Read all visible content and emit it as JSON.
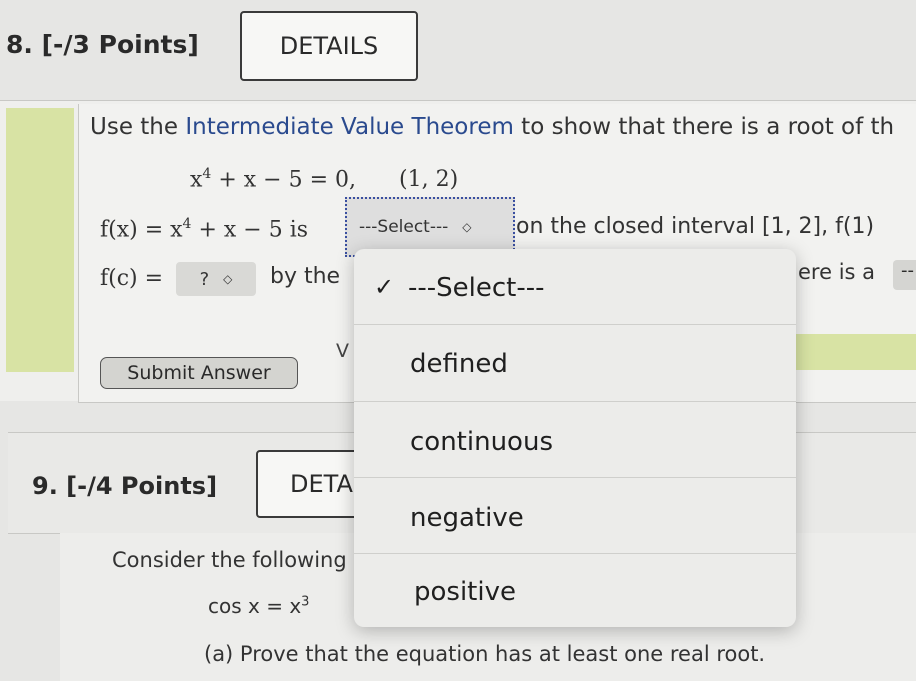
{
  "q8": {
    "title": "8.  [-/3 Points]",
    "details_label": "DETAILS",
    "prompt_intro": "Use the ",
    "prompt_theorem": "Intermediate Value Theorem",
    "prompt_rest": " to show that there is a root of th",
    "equation_lhs": "x",
    "equation_exp": "4",
    "equation_rest": " + x − 5 = 0,",
    "interval": "(1, 2)",
    "fx_label": "f(x) = x",
    "fx_exp": "4",
    "fx_rest": " + x − 5  is",
    "select1_value": "---Select---",
    "after_select1": "on the closed interval [1, 2],  f(1)",
    "fc_label": "f(c) = ",
    "select2_value": "?",
    "by_the": "by the",
    "trailing_text": "ere is a",
    "trailing_chip": "--",
    "fragment_v": "V",
    "submit_label": "Submit Answer"
  },
  "q9": {
    "title": "9.  [-/4 Points]",
    "details_label": "DETA",
    "consider": "Consider the following",
    "equation": "cos x = x",
    "equation_exp": "3",
    "part_a": "(a) Prove that the equation has at least one real root."
  },
  "dropdown": {
    "items": [
      {
        "label": "---Select---",
        "selected": true
      },
      {
        "label": "defined",
        "selected": false
      },
      {
        "label": "continuous",
        "selected": false
      },
      {
        "label": "negative",
        "selected": false
      },
      {
        "label": "positive",
        "selected": false
      }
    ],
    "check_mark": "✓"
  }
}
